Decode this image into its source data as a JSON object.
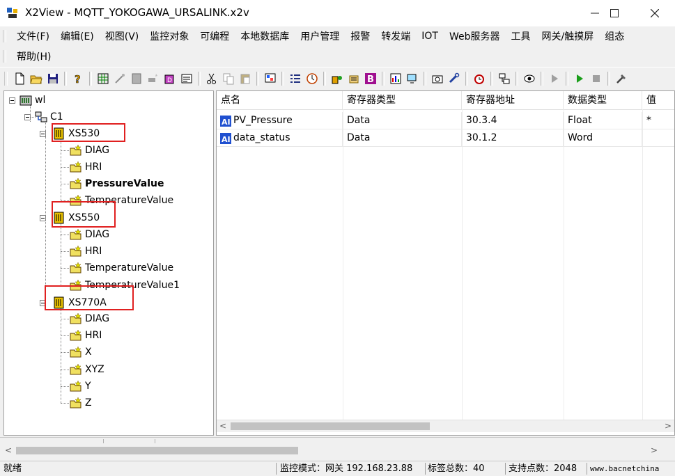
{
  "window": {
    "title": "X2View - MQTT_YOKOGAWA_URSALINK.x2v",
    "minimize": "—",
    "maximize": "☐",
    "close": "✕"
  },
  "menu": {
    "row1": [
      "文件(F)",
      "编辑(E)",
      "视图(V)",
      "监控对象",
      "可编程",
      "本地数据库",
      "用户管理",
      "报警",
      "转发端",
      "IOT",
      "Web服务器",
      "工具",
      "网关/触摸屏",
      "组态"
    ],
    "row2": [
      "帮助(H)"
    ]
  },
  "toolbar": {
    "icons": [
      "new-file-icon",
      "open-folder-icon",
      "save-icon",
      "help-icon",
      "grid-icon",
      "wand-icon",
      "device-icon",
      "device-add-icon",
      "db-icon",
      "properties-icon",
      "cut-icon",
      "copy-icon",
      "paste-icon",
      "screen-icon",
      "list-icon",
      "clock-icon",
      "run-icon",
      "config-icon",
      "b-icon",
      "chart-icon",
      "monitor-icon",
      "camera-icon",
      "wrench-icon",
      "alarm-icon",
      "network-icon",
      "eye-icon",
      "play-gray-icon",
      "play-icon",
      "stop-icon",
      "tools-icon"
    ],
    "accent_green": "#1a9e1a"
  },
  "tree": {
    "root": "wl",
    "channel": "C1",
    "devices": [
      {
        "name": "XS530",
        "children": [
          "DIAG",
          "HRI",
          "PressureValue",
          "TemperatureValue"
        ],
        "bold_child": "PressureValue"
      },
      {
        "name": "XS550",
        "children": [
          "DIAG",
          "HRI",
          "TemperatureValue",
          "TemperatureValue1"
        ]
      },
      {
        "name": "XS770A",
        "children": [
          "DIAG",
          "HRI",
          "X",
          "XYZ",
          "Y",
          "Z"
        ]
      }
    ],
    "highlight_color": "#e02020"
  },
  "grid": {
    "headers": [
      "点名",
      "寄存器类型",
      "寄存器地址",
      "数据类型",
      "值"
    ],
    "rows": [
      {
        "name": "PV_Pressure",
        "reg_type": "Data",
        "address": "30.3.4",
        "data_type": "Float",
        "value": "*"
      },
      {
        "name": "data_status",
        "reg_type": "Data",
        "address": "30.1.2",
        "data_type": "Word",
        "value": ""
      }
    ]
  },
  "status": {
    "ready": "就绪",
    "mode": "监控模式：网关 192.168.23.88",
    "tag_total": "标签总数：40",
    "support": "支持点数：2048",
    "website": "www.bacnetchina"
  }
}
